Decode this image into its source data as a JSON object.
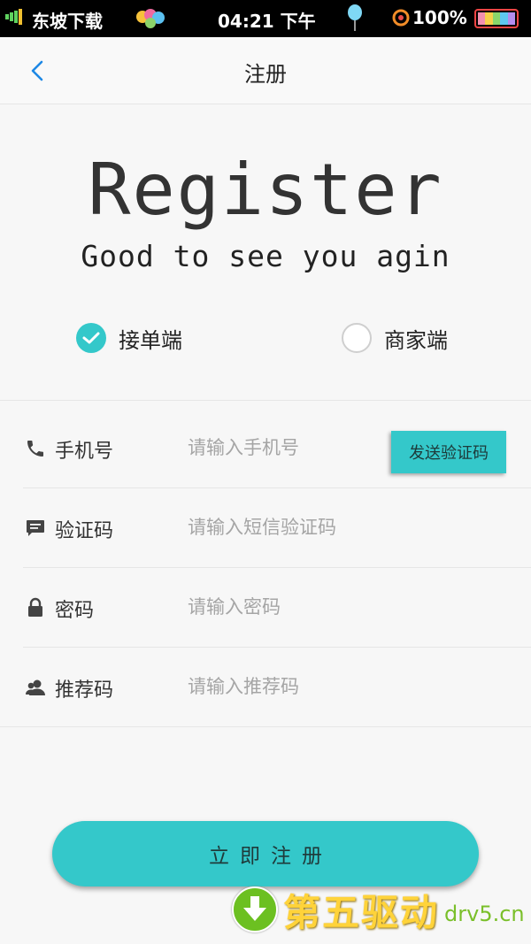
{
  "status_bar": {
    "carrier": "东坡下载",
    "time": "04:21 下午",
    "battery": "100%"
  },
  "nav": {
    "title": "注册"
  },
  "hero": {
    "title": "Register",
    "subtitle": "Good to see you agin"
  },
  "roles": {
    "courier": {
      "label": "接单端",
      "selected": true
    },
    "merchant": {
      "label": "商家端",
      "selected": false
    }
  },
  "form": {
    "phone": {
      "label": "手机号",
      "placeholder": "请输入手机号",
      "icon": "phone-icon"
    },
    "send_code_label": "发送验证码",
    "code": {
      "label": "验证码",
      "placeholder": "请输入短信验证码",
      "icon": "message-icon"
    },
    "password": {
      "label": "密码",
      "placeholder": "请输入密码",
      "icon": "lock-icon"
    },
    "referral": {
      "label": "推荐码",
      "placeholder": "请输入推荐码",
      "icon": "user-icon"
    }
  },
  "submit_label": "立即注册",
  "watermark": {
    "cn": "第五驱动",
    "en": "drv5.cn"
  },
  "colors": {
    "accent": "#34c8ca",
    "back_arrow": "#1e88e5"
  }
}
